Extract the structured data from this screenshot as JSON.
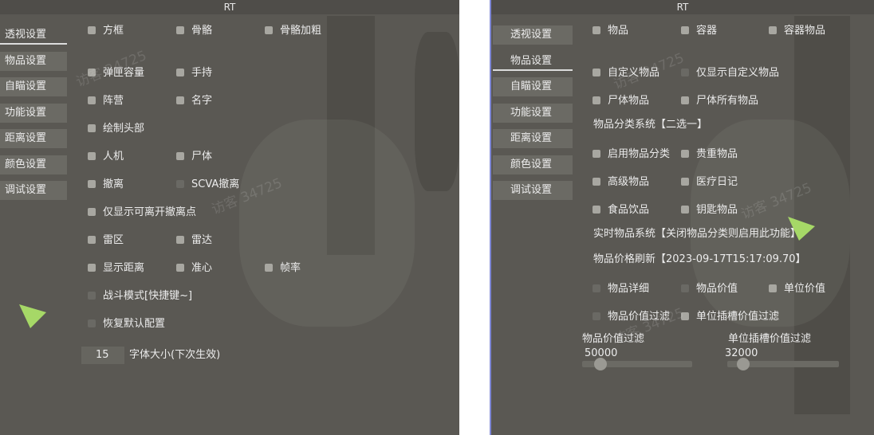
{
  "title": "RT",
  "watermark": "访客 34725",
  "colors": {
    "panel_bg": "#5a5853",
    "cursor": "#a6d867",
    "frame_border": "#7f88d6"
  },
  "left": {
    "nav": [
      "透视设置",
      "物品设置",
      "自瞄设置",
      "功能设置",
      "距离设置",
      "颜色设置",
      "调试设置"
    ],
    "options": {
      "box": "方框",
      "skeleton": "骨骼",
      "skeleton_bold": "骨骼加粗",
      "ammo": "弹匣容量",
      "held": "手持",
      "team": "阵营",
      "name": "名字",
      "draw_head": "绘制头部",
      "bot": "人机",
      "corpse": "尸体",
      "evac": "撤离",
      "scva_evac": "SCVA撤离",
      "only_open_evac": "仅显示可离开撤离点",
      "minefield": "雷区",
      "radar": "雷达",
      "show_distance": "显示距离",
      "crosshair": "准心",
      "fps": "帧率",
      "combat_mode": "战斗模式[快捷键~]",
      "restore_default": "恢复默认配置"
    },
    "font_size": {
      "value": "15",
      "label": "字体大小(下次生效)"
    }
  },
  "right": {
    "nav": [
      "透视设置",
      "物品设置",
      "自瞄设置",
      "功能设置",
      "距离设置",
      "颜色设置",
      "调试设置"
    ],
    "options": {
      "items": "物品",
      "container": "容器",
      "container_items": "容器物品",
      "custom_items": "自定义物品",
      "only_custom_items": "仅显示自定义物品",
      "corpse_items": "尸体物品",
      "corpse_all_items": "尸体所有物品",
      "enable_classify": "启用物品分类",
      "valuable_items": "贵重物品",
      "advanced_items": "高级物品",
      "medical_diary": "医疗日记",
      "food_drink": "食品饮品",
      "key_items": "钥匙物品",
      "item_detail": "物品详细",
      "item_value": "物品价值",
      "unit_value": "单位价值",
      "value_filter": "物品价值过滤",
      "unit_slot_filter": "单位插槽价值过滤"
    },
    "labels": {
      "classify_system": "物品分类系统【二选一】",
      "realtime_system": "实时物品系统【关闭物品分类则启用此功能】",
      "price_refresh": "物品价格刷新【2023-09-17T15:17:09.70】"
    },
    "sliders": {
      "value_filter": {
        "label": "物品价值过滤",
        "value": "50000",
        "fraction": 0.12
      },
      "unit_slot_filter": {
        "label": "单位插槽价值过滤",
        "value": "32000",
        "fraction": 0.1
      }
    }
  }
}
